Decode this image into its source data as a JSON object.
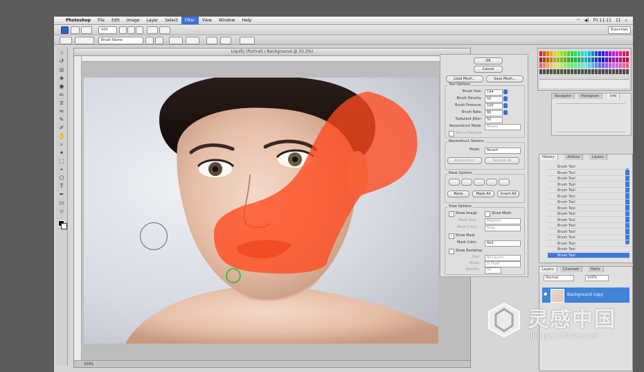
{
  "menubar": {
    "app": "Photoshop",
    "items": [
      "File",
      "Edit",
      "Image",
      "Layer",
      "Select",
      "Filter",
      "View",
      "Window",
      "Help"
    ],
    "active": "Filter",
    "clock": "Fri 11:11",
    "user": "11"
  },
  "appbar": {
    "zoom": "100",
    "workspace": "Essentials"
  },
  "optionsbar": {
    "brush_preset": "Brush Name"
  },
  "document": {
    "title": "Liquify (Portrait / Background @ 33.3%)",
    "status": "100%"
  },
  "dialog": {
    "ok": "OK",
    "cancel": "Cancel",
    "load_mesh": "Load Mesh...",
    "save_mesh": "Save Mesh...",
    "tool_options_title": "Tool Options",
    "tool_options": [
      {
        "label": "Brush Size:",
        "value": "144"
      },
      {
        "label": "Brush Density:",
        "value": "50"
      },
      {
        "label": "Brush Pressure:",
        "value": "100"
      },
      {
        "label": "Brush Rate:",
        "value": "80"
      },
      {
        "label": "Turbulent Jitter:",
        "value": "50"
      },
      {
        "label": "Reconstruct Mode:",
        "value": "Revert"
      }
    ],
    "stylus_pressure": "Stylus Pressure",
    "reconstruct_title": "Reconstruct Options",
    "mode_label": "Mode:",
    "mode_value": "Revert",
    "reconstruct_btn": "Reconstruct",
    "restore_all_btn": "Restore All",
    "mask_title": "Mask Options",
    "mask_none": "None",
    "mask_all": "Mask All",
    "invert_all": "Invert All",
    "view_title": "View Options",
    "show_image": "Show Image",
    "show_mesh": "Show Mesh",
    "mesh_size_label": "Mesh Size:",
    "mesh_size": "Medium",
    "mesh_color_label": "Mesh Color:",
    "mesh_color": "Gray",
    "show_mask": "Show Mask",
    "mask_color_label": "Mask Color:",
    "mask_color": "Red",
    "show_backdrop": "Show Backdrop",
    "use_label": "Use:",
    "use_value": "All Layers",
    "backdrop_mode_label": "Mode:",
    "backdrop_mode": "In Front",
    "opacity_label": "Opacity:",
    "opacity": "50"
  },
  "navigator": {
    "tabs": [
      "Navigator",
      "Histogram",
      "Info"
    ]
  },
  "history": {
    "tabs": [
      "History",
      "Actions",
      "Layers"
    ],
    "rows": [
      "Brush Tool",
      "Brush Tool",
      "Brush Tool",
      "Brush Tool",
      "Brush Tool",
      "Brush Tool",
      "Brush Tool",
      "Brush Tool",
      "Brush Tool",
      "Brush Tool",
      "Brush Tool",
      "Brush Tool",
      "Brush Tool",
      "Brush Tool",
      "Brush Tool",
      "Brush Tool"
    ],
    "selected": "Brush Tool"
  },
  "layers": {
    "tabs": [
      "Layers",
      "Channels",
      "Paths"
    ],
    "blend": "Normal",
    "opacity": "100%",
    "layer_name": "Background copy"
  },
  "watermark": {
    "chinese": "灵感中国",
    "english": "lingganchina.com"
  },
  "colors": {
    "mask_overlay": "#ff5a2e",
    "selection": "#3a70d6",
    "brush_cursor_active": "#46b84a"
  }
}
